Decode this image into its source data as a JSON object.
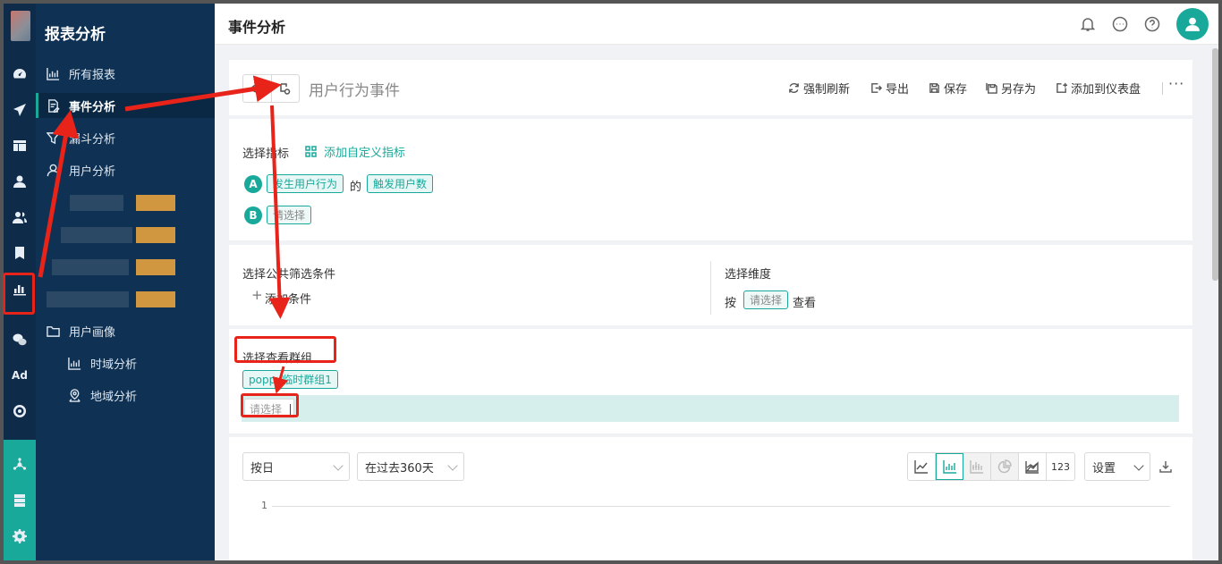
{
  "sidebar": {
    "title": "报表分析",
    "items": [
      {
        "label": "所有报表",
        "icon": "bar-chart-icon"
      },
      {
        "label": "事件分析",
        "icon": "edit-doc-icon",
        "active": true
      },
      {
        "label": "漏斗分析",
        "icon": "funnel-icon"
      },
      {
        "label": "用户分析",
        "icon": "user-icon"
      },
      {
        "label": "用户画像",
        "icon": "folder-icon"
      },
      {
        "label": "时域分析",
        "icon": "bar-chart-icon"
      },
      {
        "label": "地域分析",
        "icon": "location-icon"
      }
    ],
    "rail_icons": [
      "dashboard-icon",
      "send-icon",
      "layout-icon",
      "user-icon",
      "users-icon",
      "bookmark-icon",
      "bar-chart-icon",
      "wechat-icon",
      "Ad",
      "target-icon",
      "network-icon",
      "server-icon",
      "gear-icon"
    ]
  },
  "header": {
    "title": "事件分析",
    "icons": [
      "bell-icon",
      "chat-icon",
      "help-icon",
      "avatar"
    ]
  },
  "toolbar": {
    "event_name": "用户行为事件",
    "actions": [
      "强制刷新",
      "导出",
      "保存",
      "另存为",
      "添加到仪表盘"
    ],
    "more": "···"
  },
  "metrics": {
    "title": "选择指标",
    "add_custom": "添加自定义指标",
    "rows": [
      {
        "badge": "A",
        "behavior": "发生用户行为",
        "connector": "的",
        "measure": "触发用户数"
      },
      {
        "badge": "B",
        "placeholder": "请选择"
      }
    ]
  },
  "filters": {
    "title": "选择公共筛选条件",
    "add": "添加条件",
    "dimension_title": "选择维度",
    "by": "按",
    "dimension_placeholder": "请选择",
    "view": "查看"
  },
  "groups": {
    "title": "选择查看群组",
    "selected": "poppy临时群组1",
    "input_placeholder": "请选择"
  },
  "chart_controls": {
    "granularity": "按日",
    "range": "在过去360天",
    "chart_types": [
      "line-chart-icon",
      "bar-chart-icon",
      "stacked-bar-icon",
      "pie-chart-icon",
      "area-chart-icon",
      "123"
    ],
    "settings": "设置",
    "download": "download-icon"
  },
  "chart_data": {
    "type": "line",
    "y_ticks": [
      "1"
    ],
    "series": []
  },
  "annotations": {
    "color": "#e8231a"
  }
}
